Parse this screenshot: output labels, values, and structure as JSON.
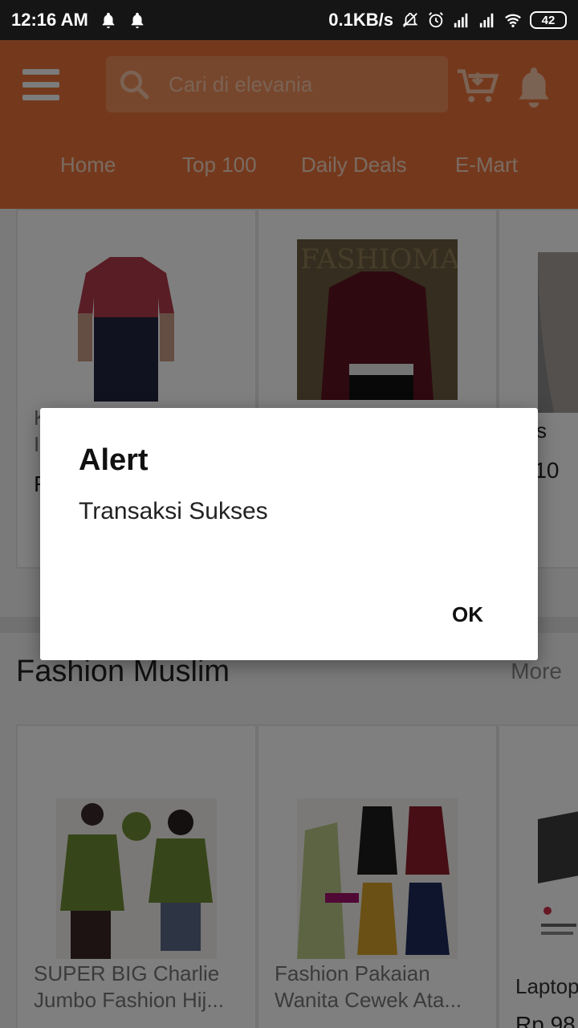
{
  "status_bar": {
    "time": "12:16 AM",
    "net_speed": "0.1KB/s",
    "battery": "42"
  },
  "header": {
    "search_placeholder": "Cari di elevania",
    "nav": [
      "Home",
      "Top 100",
      "Daily Deals",
      "E-Mart"
    ]
  },
  "products_row1": [
    {
      "name": "K",
      "name2": "I",
      "price": "R"
    },
    {
      "name": "",
      "name2": "",
      "price": ""
    },
    {
      "name": "sks",
      "price": "p 10"
    }
  ],
  "section": {
    "title": "Fashion Muslim",
    "more": "More"
  },
  "products_row2": [
    {
      "name_line1": "SUPER BIG Charlie",
      "name_line2": "Jumbo Fashion Hij..."
    },
    {
      "name_line1": "Fashion Pakaian",
      "name_line2": "Wanita Cewek Ata..."
    },
    {
      "name_line1": "Laptop",
      "price": "Rp 98"
    }
  ],
  "dialog": {
    "title": "Alert",
    "message": "Transaksi Sukses",
    "ok": "OK"
  },
  "colors": {
    "brand_orange": "#e8733a",
    "status_bar": "#151515"
  }
}
